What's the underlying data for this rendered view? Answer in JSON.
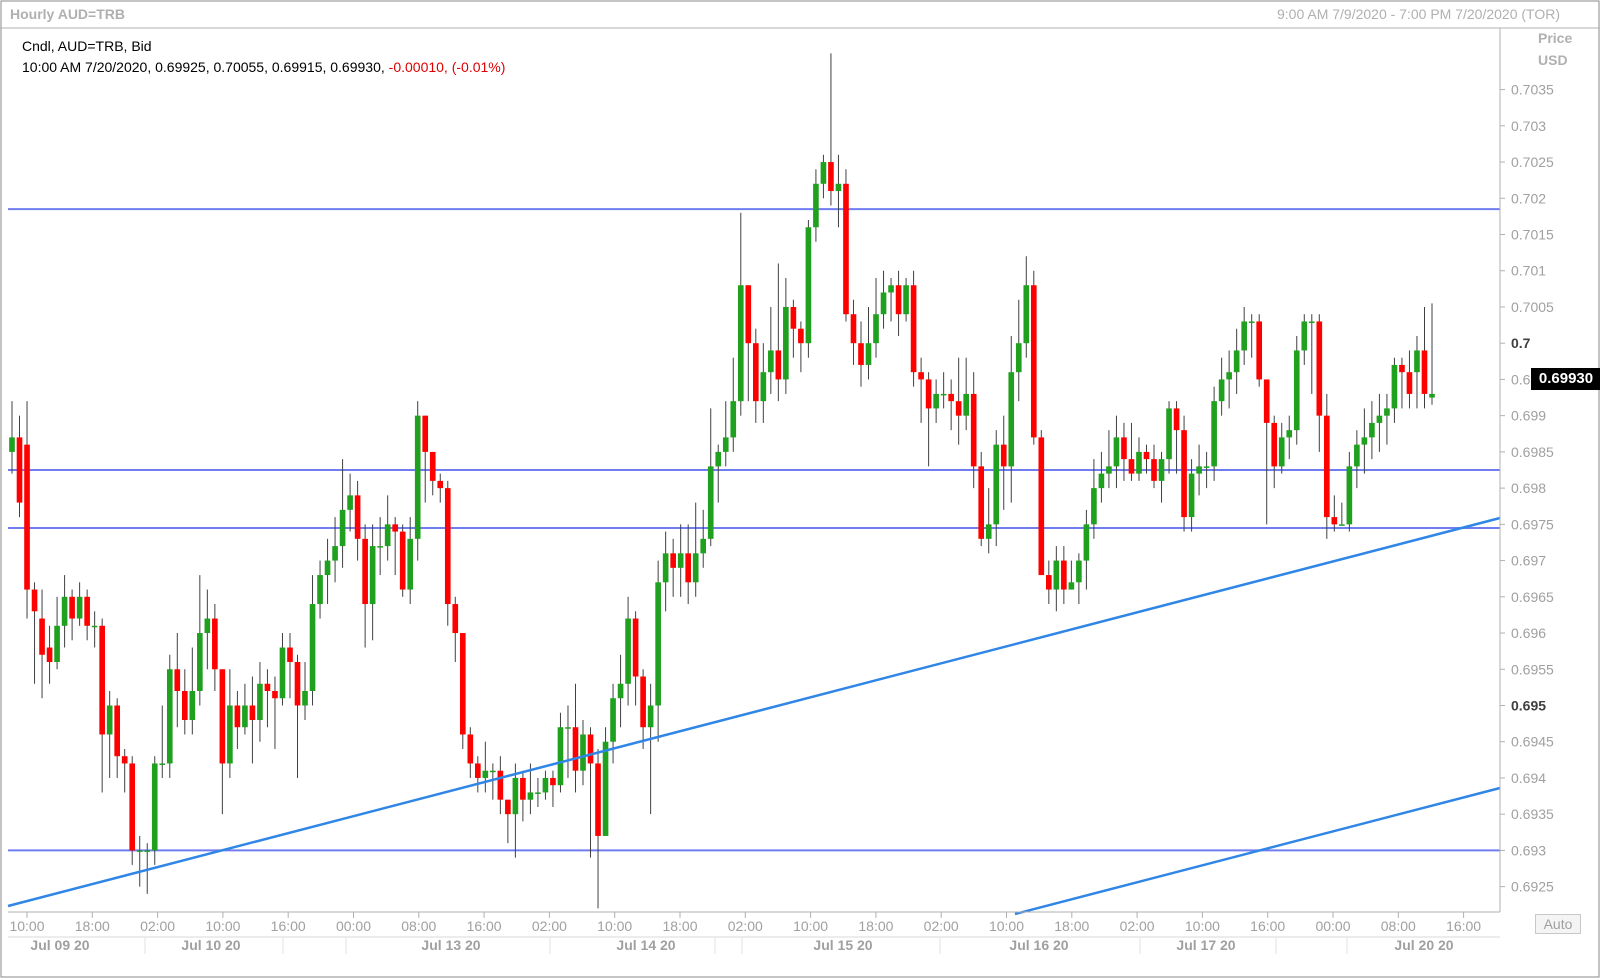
{
  "header": {
    "title": "Hourly AUD=TRB",
    "range": "9:00 AM 7/9/2020 - 7:00 PM 7/20/2020 (TOR)"
  },
  "legend": {
    "line1": "Cndl, AUD=TRB, Bid",
    "line2_main": "10:00 AM 7/20/2020, 0.69925, 0.70055, 0.69915, 0.69930, ",
    "line2_change": "-0.00010, (-0.01%)"
  },
  "axis": {
    "title_line1": "Price",
    "title_line2": "USD",
    "auto_label": "Auto",
    "last_price_label": "0.69930"
  },
  "colors": {
    "up": "#1fa01f",
    "down": "#ff0000",
    "hline": "#6f7df0",
    "trend": "#2f86e6",
    "grid": "#ececec"
  },
  "chart_data": {
    "type": "candlestick",
    "instrument": "AUD=TRB",
    "interval": "Hourly",
    "ylim": [
      0.692,
      0.7045
    ],
    "y_ticks": [
      {
        "label": "0.7035",
        "v": 0.7035,
        "bold": false
      },
      {
        "label": "0.703",
        "v": 0.703,
        "bold": false
      },
      {
        "label": "0.7025",
        "v": 0.7025,
        "bold": false
      },
      {
        "label": "0.702",
        "v": 0.702,
        "bold": false
      },
      {
        "label": "0.7015",
        "v": 0.7015,
        "bold": false
      },
      {
        "label": "0.701",
        "v": 0.701,
        "bold": false
      },
      {
        "label": "0.7005",
        "v": 0.7005,
        "bold": false
      },
      {
        "label": "0.7",
        "v": 0.7,
        "bold": true
      },
      {
        "label": "0.6995",
        "v": 0.6995,
        "bold": false
      },
      {
        "label": "0.699",
        "v": 0.699,
        "bold": false
      },
      {
        "label": "0.6985",
        "v": 0.6985,
        "bold": false
      },
      {
        "label": "0.698",
        "v": 0.698,
        "bold": false
      },
      {
        "label": "0.6975",
        "v": 0.6975,
        "bold": false
      },
      {
        "label": "0.697",
        "v": 0.697,
        "bold": false
      },
      {
        "label": "0.6965",
        "v": 0.6965,
        "bold": false
      },
      {
        "label": "0.696",
        "v": 0.696,
        "bold": false
      },
      {
        "label": "0.6955",
        "v": 0.6955,
        "bold": false
      },
      {
        "label": "0.695",
        "v": 0.695,
        "bold": true
      },
      {
        "label": "0.6945",
        "v": 0.6945,
        "bold": false
      },
      {
        "label": "0.694",
        "v": 0.694,
        "bold": false
      },
      {
        "label": "0.6935",
        "v": 0.6935,
        "bold": false
      },
      {
        "label": "0.693",
        "v": 0.693,
        "bold": false
      },
      {
        "label": "0.6925",
        "v": 0.6925,
        "bold": false
      }
    ],
    "x_ticks": [
      "10:00",
      "18:00",
      "02:00",
      "10:00",
      "16:00",
      "00:00",
      "08:00",
      "16:00",
      "02:00",
      "10:00",
      "18:00",
      "02:00",
      "10:00",
      "18:00",
      "02:00",
      "10:00",
      "18:00",
      "02:00",
      "10:00",
      "16:00",
      "00:00",
      "08:00",
      "16:00"
    ],
    "x_dates": [
      "Jul 09 20",
      "Jul 10 20",
      "Jul 13 20",
      "Jul 14 20",
      "Jul 15 20",
      "Jul 16 20",
      "Jul 17 20",
      "Jul 20 20"
    ],
    "horizontal_lines": [
      0.70185,
      0.69825,
      0.69745,
      0.693
    ],
    "trend_lines": [
      {
        "from": [
          "Jul 09 20 10:00",
          0.69225
        ],
        "to": [
          "Jul 20 20 19:00",
          0.69725
        ]
      },
      {
        "from": [
          "Jul 16 20 12:00",
          0.69225
        ],
        "to": [
          "Jul 20 20 19:00",
          0.69365
        ]
      }
    ],
    "last": {
      "time": "10:00 AM 7/20/2020",
      "open": 0.69925,
      "high": 0.70055,
      "low": 0.69915,
      "close": 0.6993
    },
    "candles": [
      [
        0.6985,
        0.6987,
        0.6982,
        0.6992
      ],
      [
        0.6987,
        0.6978,
        0.6976,
        0.699
      ],
      [
        0.6986,
        0.6966,
        0.6962,
        0.6992
      ],
      [
        0.6966,
        0.6963,
        0.6953,
        0.6967
      ],
      [
        0.6962,
        0.6957,
        0.6951,
        0.6966
      ],
      [
        0.6958,
        0.6956,
        0.6953,
        0.6961
      ],
      [
        0.6956,
        0.6961,
        0.6955,
        0.6965
      ],
      [
        0.6961,
        0.6965,
        0.6958,
        0.6968
      ],
      [
        0.6965,
        0.6962,
        0.6959,
        0.6966
      ],
      [
        0.6962,
        0.6965,
        0.6961,
        0.6967
      ],
      [
        0.6965,
        0.6961,
        0.6959,
        0.6966
      ],
      [
        0.6961,
        0.6961,
        0.6958,
        0.6963
      ],
      [
        0.6961,
        0.6946,
        0.6938,
        0.6962
      ],
      [
        0.6946,
        0.695,
        0.694,
        0.6952
      ],
      [
        0.695,
        0.6943,
        0.694,
        0.6951
      ],
      [
        0.6943,
        0.6942,
        0.6938,
        0.6944
      ],
      [
        0.6942,
        0.693,
        0.6928,
        0.6943
      ],
      [
        0.693,
        0.693,
        0.6925,
        0.6932
      ],
      [
        0.693,
        0.693,
        0.6924,
        0.6931
      ],
      [
        0.693,
        0.6942,
        0.6928,
        0.6943
      ],
      [
        0.6942,
        0.6942,
        0.694,
        0.695
      ],
      [
        0.6942,
        0.6955,
        0.694,
        0.6957
      ],
      [
        0.6955,
        0.6952,
        0.6947,
        0.696
      ],
      [
        0.6952,
        0.6948,
        0.6946,
        0.6955
      ],
      [
        0.6948,
        0.6952,
        0.6946,
        0.6958
      ],
      [
        0.6952,
        0.696,
        0.695,
        0.6968
      ],
      [
        0.696,
        0.6962,
        0.6955,
        0.6966
      ],
      [
        0.6962,
        0.6955,
        0.6952,
        0.6964
      ],
      [
        0.6955,
        0.6942,
        0.6935,
        0.6955
      ],
      [
        0.6942,
        0.695,
        0.694,
        0.6955
      ],
      [
        0.695,
        0.6947,
        0.6944,
        0.6952
      ],
      [
        0.6947,
        0.695,
        0.6946,
        0.6953
      ],
      [
        0.695,
        0.6948,
        0.6942,
        0.6954
      ],
      [
        0.6948,
        0.6953,
        0.6945,
        0.6956
      ],
      [
        0.6953,
        0.6952,
        0.6947,
        0.6955
      ],
      [
        0.6952,
        0.6951,
        0.6944,
        0.6954
      ],
      [
        0.6951,
        0.6958,
        0.695,
        0.696
      ],
      [
        0.6958,
        0.6956,
        0.6951,
        0.696
      ],
      [
        0.6956,
        0.695,
        0.694,
        0.6957
      ],
      [
        0.695,
        0.6952,
        0.6948,
        0.6956
      ],
      [
        0.6952,
        0.6964,
        0.695,
        0.6968
      ],
      [
        0.6964,
        0.6968,
        0.6962,
        0.697
      ],
      [
        0.6968,
        0.697,
        0.6964,
        0.6973
      ],
      [
        0.697,
        0.6972,
        0.6967,
        0.6976
      ],
      [
        0.6972,
        0.6977,
        0.6969,
        0.6984
      ],
      [
        0.6977,
        0.6979,
        0.6974,
        0.6982
      ],
      [
        0.6979,
        0.6973,
        0.697,
        0.6981
      ],
      [
        0.6973,
        0.6964,
        0.6958,
        0.6975
      ],
      [
        0.6964,
        0.6972,
        0.6959,
        0.6975
      ],
      [
        0.6972,
        0.6972,
        0.6968,
        0.6976
      ],
      [
        0.6972,
        0.6975,
        0.697,
        0.6979
      ],
      [
        0.6975,
        0.6974,
        0.6968,
        0.6976
      ],
      [
        0.6974,
        0.6966,
        0.6965,
        0.6975
      ],
      [
        0.6966,
        0.6973,
        0.6964,
        0.6976
      ],
      [
        0.6973,
        0.699,
        0.697,
        0.6992
      ],
      [
        0.699,
        0.6985,
        0.6978,
        0.699
      ],
      [
        0.6985,
        0.6981,
        0.6979,
        0.6984
      ],
      [
        0.6981,
        0.698,
        0.6978,
        0.6982
      ],
      [
        0.698,
        0.6964,
        0.6961,
        0.6981
      ],
      [
        0.6964,
        0.696,
        0.6956,
        0.6965
      ],
      [
        0.696,
        0.6946,
        0.6944,
        0.696
      ],
      [
        0.6946,
        0.6942,
        0.694,
        0.6947
      ],
      [
        0.6942,
        0.694,
        0.6938,
        0.6943
      ],
      [
        0.694,
        0.6941,
        0.6938,
        0.6945
      ],
      [
        0.6941,
        0.6941,
        0.6937,
        0.6942
      ],
      [
        0.6941,
        0.6937,
        0.6935,
        0.6943
      ],
      [
        0.6937,
        0.6935,
        0.6931,
        0.6937
      ],
      [
        0.6935,
        0.694,
        0.6929,
        0.6942
      ],
      [
        0.694,
        0.6937,
        0.6934,
        0.6941
      ],
      [
        0.6937,
        0.6938,
        0.6935,
        0.6942
      ],
      [
        0.6938,
        0.6938,
        0.6936,
        0.694
      ],
      [
        0.6938,
        0.694,
        0.6937,
        0.6941
      ],
      [
        0.694,
        0.6939,
        0.6936,
        0.6941
      ],
      [
        0.6939,
        0.6947,
        0.6938,
        0.6949
      ],
      [
        0.6947,
        0.6947,
        0.694,
        0.695
      ],
      [
        0.6947,
        0.6941,
        0.6938,
        0.6953
      ],
      [
        0.6941,
        0.6946,
        0.6939,
        0.6948
      ],
      [
        0.6946,
        0.6942,
        0.6929,
        0.6947
      ],
      [
        0.6942,
        0.6932,
        0.6922,
        0.6944
      ],
      [
        0.6932,
        0.6945,
        0.6932,
        0.6947
      ],
      [
        0.6945,
        0.6951,
        0.6942,
        0.6953
      ],
      [
        0.6951,
        0.6953,
        0.6947,
        0.6957
      ],
      [
        0.6953,
        0.6962,
        0.695,
        0.6965
      ],
      [
        0.6962,
        0.6954,
        0.695,
        0.6963
      ],
      [
        0.6954,
        0.6947,
        0.6944,
        0.6955
      ],
      [
        0.6947,
        0.695,
        0.6935,
        0.6953
      ],
      [
        0.695,
        0.6967,
        0.6945,
        0.697
      ],
      [
        0.6967,
        0.6971,
        0.6963,
        0.6974
      ],
      [
        0.6971,
        0.6969,
        0.6965,
        0.6973
      ],
      [
        0.6969,
        0.6971,
        0.6965,
        0.6975
      ],
      [
        0.6971,
        0.6967,
        0.6964,
        0.6975
      ],
      [
        0.6967,
        0.6971,
        0.6965,
        0.6978
      ],
      [
        0.6971,
        0.6973,
        0.6969,
        0.6977
      ],
      [
        0.6973,
        0.6983,
        0.6972,
        0.6991
      ],
      [
        0.6983,
        0.6985,
        0.6978,
        0.6986
      ],
      [
        0.6985,
        0.6987,
        0.6983,
        0.6992
      ],
      [
        0.6987,
        0.6992,
        0.6985,
        0.6998
      ],
      [
        0.6992,
        0.7008,
        0.699,
        0.7018
      ],
      [
        0.7008,
        0.7,
        0.6992,
        0.7008
      ],
      [
        0.7,
        0.6992,
        0.6989,
        0.7002
      ],
      [
        0.6992,
        0.6996,
        0.6989,
        0.7
      ],
      [
        0.6996,
        0.6999,
        0.6993,
        0.7005
      ],
      [
        0.6999,
        0.6995,
        0.6992,
        0.7011
      ],
      [
        0.6995,
        0.7005,
        0.6993,
        0.7009
      ],
      [
        0.7005,
        0.7002,
        0.6998,
        0.7006
      ],
      [
        0.7002,
        0.7,
        0.6996,
        0.7003
      ],
      [
        0.7,
        0.7016,
        0.6998,
        0.7017
      ],
      [
        0.7016,
        0.7022,
        0.7014,
        0.7024
      ],
      [
        0.7022,
        0.7025,
        0.702,
        0.7026
      ],
      [
        0.7025,
        0.7021,
        0.7019,
        0.704
      ],
      [
        0.7021,
        0.7022,
        0.7016,
        0.7026
      ],
      [
        0.7022,
        0.7004,
        0.7003,
        0.7024
      ],
      [
        0.7004,
        0.7,
        0.6997,
        0.7006
      ],
      [
        0.7,
        0.6997,
        0.6994,
        0.7003
      ],
      [
        0.6997,
        0.7,
        0.6995,
        0.7005
      ],
      [
        0.7,
        0.7004,
        0.6998,
        0.7009
      ],
      [
        0.7004,
        0.7007,
        0.7002,
        0.701
      ],
      [
        0.7007,
        0.7008,
        0.7003,
        0.7009
      ],
      [
        0.7008,
        0.7004,
        0.7001,
        0.701
      ],
      [
        0.7004,
        0.7008,
        0.7003,
        0.7009
      ],
      [
        0.7008,
        0.6996,
        0.6994,
        0.701
      ],
      [
        0.6996,
        0.6995,
        0.6989,
        0.6998
      ],
      [
        0.6995,
        0.6991,
        0.6983,
        0.6996
      ],
      [
        0.6991,
        0.6993,
        0.6989,
        0.6995
      ],
      [
        0.6993,
        0.6993,
        0.6991,
        0.6996
      ],
      [
        0.6993,
        0.6992,
        0.6988,
        0.6995
      ],
      [
        0.6992,
        0.699,
        0.6986,
        0.6998
      ],
      [
        0.699,
        0.6993,
        0.6988,
        0.6998
      ],
      [
        0.6993,
        0.6983,
        0.698,
        0.6996
      ],
      [
        0.6983,
        0.6973,
        0.6972,
        0.6985
      ],
      [
        0.6973,
        0.6975,
        0.6971,
        0.698
      ],
      [
        0.6975,
        0.6986,
        0.6972,
        0.6988
      ],
      [
        0.6986,
        0.6983,
        0.6977,
        0.699
      ],
      [
        0.6983,
        0.6996,
        0.6978,
        0.7001
      ],
      [
        0.6996,
        0.7,
        0.6992,
        0.7006
      ],
      [
        0.7,
        0.7008,
        0.6998,
        0.7012
      ],
      [
        0.7008,
        0.6987,
        0.6986,
        0.701
      ],
      [
        0.6987,
        0.6968,
        0.6968,
        0.6988
      ],
      [
        0.6968,
        0.6966,
        0.6964,
        0.697
      ],
      [
        0.6966,
        0.697,
        0.6963,
        0.6972
      ],
      [
        0.697,
        0.6966,
        0.6964,
        0.6972
      ],
      [
        0.6966,
        0.6967,
        0.6966,
        0.697
      ],
      [
        0.6967,
        0.697,
        0.6964,
        0.6971
      ],
      [
        0.697,
        0.6975,
        0.6966,
        0.6977
      ],
      [
        0.6975,
        0.698,
        0.6973,
        0.6984
      ],
      [
        0.698,
        0.6982,
        0.6978,
        0.6985
      ],
      [
        0.6982,
        0.6983,
        0.698,
        0.6988
      ],
      [
        0.6983,
        0.6987,
        0.698,
        0.699
      ],
      [
        0.6987,
        0.6984,
        0.6981,
        0.6989
      ],
      [
        0.6984,
        0.6982,
        0.6981,
        0.6989
      ],
      [
        0.6982,
        0.6985,
        0.6981,
        0.6987
      ],
      [
        0.6985,
        0.6984,
        0.6982,
        0.6986
      ],
      [
        0.6984,
        0.6981,
        0.698,
        0.6986
      ],
      [
        0.6981,
        0.6984,
        0.6978,
        0.6985
      ],
      [
        0.6984,
        0.6991,
        0.6982,
        0.6992
      ],
      [
        0.6991,
        0.6988,
        0.6982,
        0.6992
      ],
      [
        0.6988,
        0.6976,
        0.6974,
        0.699
      ],
      [
        0.6976,
        0.6982,
        0.6974,
        0.6984
      ],
      [
        0.6982,
        0.6983,
        0.6979,
        0.6986
      ],
      [
        0.6983,
        0.6983,
        0.698,
        0.6985
      ],
      [
        0.6983,
        0.6992,
        0.6981,
        0.6994
      ],
      [
        0.6992,
        0.6995,
        0.699,
        0.6998
      ],
      [
        0.6995,
        0.6996,
        0.6991,
        0.6999
      ],
      [
        0.6996,
        0.6999,
        0.6993,
        0.7002
      ],
      [
        0.6999,
        0.7003,
        0.6997,
        0.7005
      ],
      [
        0.7003,
        0.7003,
        0.6998,
        0.7004
      ],
      [
        0.7003,
        0.6995,
        0.6994,
        0.7004
      ],
      [
        0.6995,
        0.6989,
        0.6975,
        0.6993
      ],
      [
        0.6989,
        0.6983,
        0.698,
        0.699
      ],
      [
        0.6983,
        0.6987,
        0.6982,
        0.6989
      ],
      [
        0.6987,
        0.6988,
        0.6984,
        0.699
      ],
      [
        0.6988,
        0.6999,
        0.6986,
        0.7001
      ],
      [
        0.6999,
        0.7003,
        0.6997,
        0.7004
      ],
      [
        0.7003,
        0.7003,
        0.6993,
        0.7004
      ],
      [
        0.7003,
        0.699,
        0.6985,
        0.7004
      ],
      [
        0.699,
        0.6976,
        0.6973,
        0.6993
      ],
      [
        0.6976,
        0.6975,
        0.6974,
        0.6979
      ],
      [
        0.6975,
        0.6975,
        0.6975,
        0.6978
      ],
      [
        0.6975,
        0.6983,
        0.6974,
        0.6985
      ],
      [
        0.6983,
        0.6986,
        0.698,
        0.6988
      ],
      [
        0.6986,
        0.6987,
        0.6982,
        0.6991
      ],
      [
        0.6987,
        0.6989,
        0.6984,
        0.6992
      ],
      [
        0.6989,
        0.699,
        0.6985,
        0.6993
      ],
      [
        0.699,
        0.6991,
        0.6986,
        0.6993
      ],
      [
        0.6991,
        0.6997,
        0.6989,
        0.6998
      ],
      [
        0.6997,
        0.6996,
        0.6991,
        0.6998
      ],
      [
        0.6996,
        0.6993,
        0.6991,
        0.6999
      ],
      [
        0.6996,
        0.6999,
        0.6991,
        0.7001
      ],
      [
        0.6999,
        0.6993,
        0.6991,
        0.7005
      ],
      [
        0.69925,
        0.6993,
        0.69915,
        0.70055
      ]
    ]
  }
}
